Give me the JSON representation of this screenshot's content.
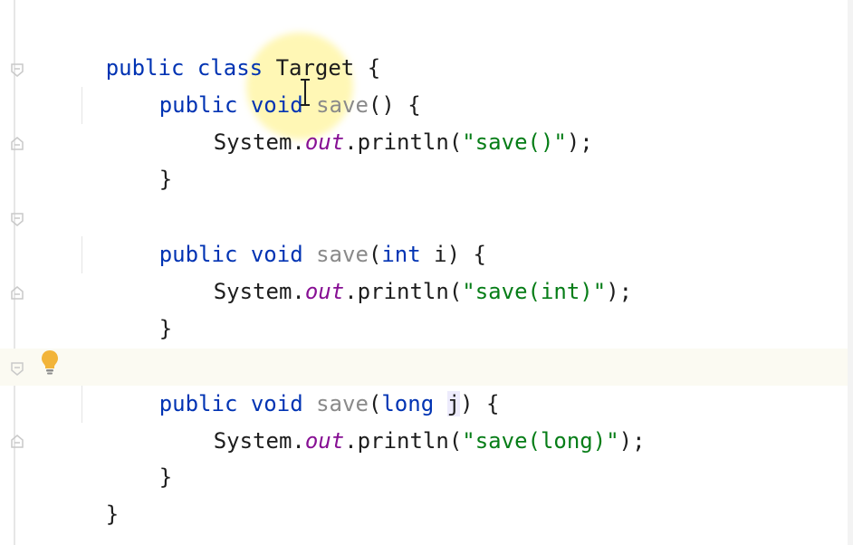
{
  "code": {
    "kw_public": "public",
    "kw_class": "class",
    "class_name": "Target",
    "open_brace": "{",
    "close_brace": "}",
    "kw_void": "void",
    "method_name": "save",
    "m1_params": "() {",
    "m2_params_open": "(",
    "m2_param_type": "int",
    "m2_param_name": " i",
    "m2_params_close": ") {",
    "m3_params_open": "(",
    "m3_param_type": "long",
    "m3_param_name": "j",
    "m3_params_close": ") {",
    "sys": "System.",
    "out": "out",
    "println_open": ".println(",
    "str1": "\"save()\"",
    "str2": "\"save(int)\"",
    "str3": "\"save(long)\"",
    "stmt_end": ");"
  },
  "ui": {
    "accent_colors": {
      "keyword": "#0033b3",
      "string": "#067d17",
      "field": "#871094",
      "method_name": "#8a8a8a"
    },
    "icons": [
      "fold-arrow-icon",
      "intention-bulb-icon",
      "text-cursor-icon"
    ]
  }
}
